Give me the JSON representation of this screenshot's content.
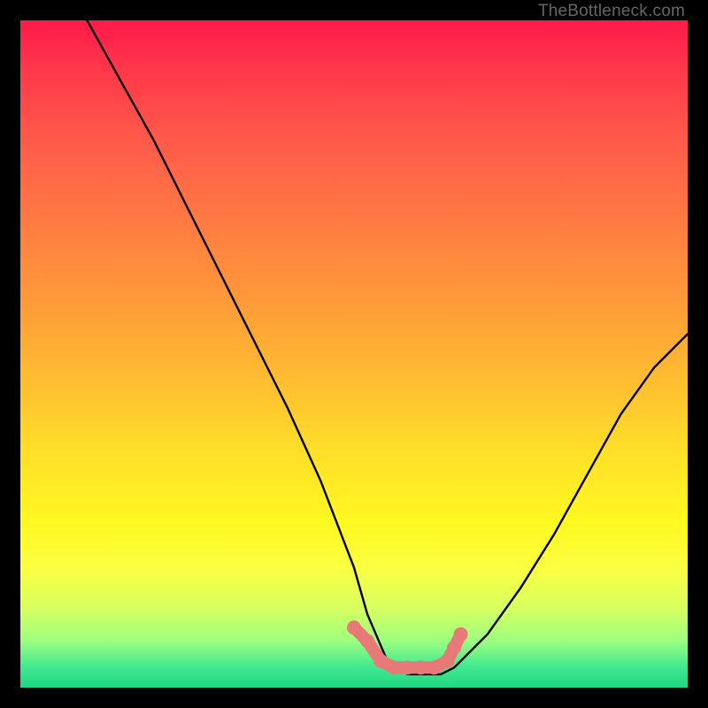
{
  "watermark": "TheBottleneck.com",
  "chart_data": {
    "type": "line",
    "title": "",
    "xlabel": "",
    "ylabel": "",
    "ylim": [
      0,
      100
    ],
    "xlim": [
      0,
      100
    ],
    "series": [
      {
        "name": "bottleneck-curve",
        "x": [
          10,
          15,
          20,
          25,
          30,
          35,
          40,
          45,
          50,
          52,
          55,
          58,
          60,
          63,
          65,
          70,
          75,
          80,
          85,
          90,
          95,
          100
        ],
        "values": [
          100,
          91,
          82,
          72,
          62,
          52,
          42,
          31,
          18,
          11,
          4,
          2,
          2,
          2,
          3,
          8,
          15,
          23,
          32,
          41,
          48,
          53
        ]
      }
    ],
    "annotations": [
      {
        "name": "valley-dots",
        "x": [
          50,
          52,
          54,
          56,
          58,
          60,
          62,
          64,
          65,
          66
        ],
        "values": [
          9,
          7,
          4,
          3,
          3,
          3,
          3,
          4,
          6,
          8
        ],
        "color": "#e77a78",
        "style": "dots"
      }
    ]
  }
}
